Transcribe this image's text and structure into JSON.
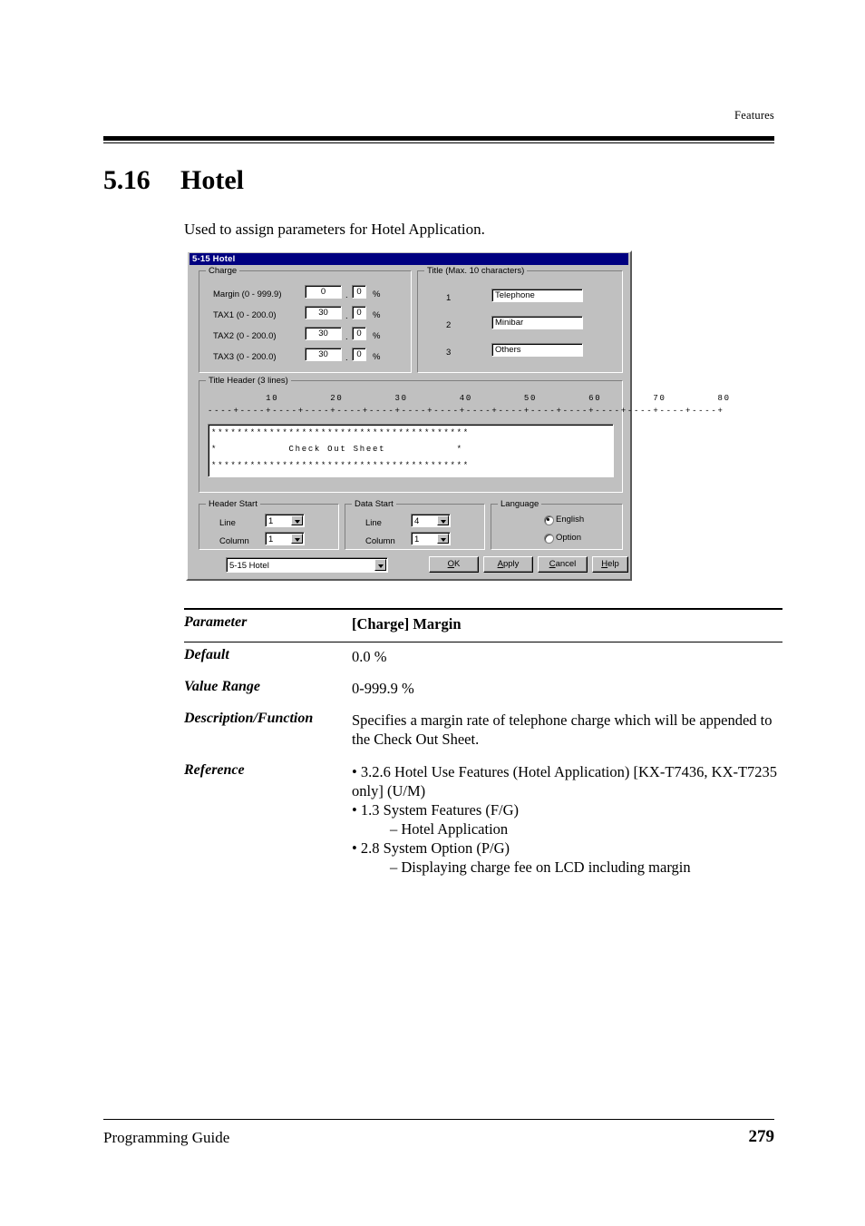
{
  "page": {
    "running_header": "Features",
    "section_number": "5.16",
    "section_title": "Hotel",
    "intro": "Used to assign parameters for Hotel Application.",
    "footer_left": "Programming Guide",
    "footer_page": "279"
  },
  "dialog": {
    "title": "5-15 Hotel",
    "charge": {
      "group_label": "Charge",
      "rows": [
        {
          "label": "Margin (0 - 999.9)",
          "int": "0",
          "dec": "0",
          "unit": "%"
        },
        {
          "label": "TAX1 (0 - 200.0)",
          "int": "30",
          "dec": "0",
          "unit": "%"
        },
        {
          "label": "TAX2 (0 - 200.0)",
          "int": "30",
          "dec": "0",
          "unit": "%"
        },
        {
          "label": "TAX3 (0 - 200.0)",
          "int": "30",
          "dec": "0",
          "unit": "%"
        }
      ],
      "decimal_separator": "."
    },
    "title_group": {
      "group_label": "Title (Max. 10 characters)",
      "rows": [
        {
          "num": "1",
          "value": "Telephone"
        },
        {
          "num": "2",
          "value": "Minibar"
        },
        {
          "num": "3",
          "value": "Others"
        }
      ]
    },
    "title_header": {
      "group_label": "Title Header (3 lines)",
      "ruler_numbers": "         10        20        30        40        50        60        70        80",
      "ruler_ticks": "----+----+----+----+----+----+----+----+----+----+----+----+----+----+----+----+",
      "lines": [
        "****************************************",
        "*           Check Out Sheet           *",
        "****************************************"
      ]
    },
    "header_start": {
      "group_label": "Header Start",
      "line_label": "Line",
      "line_value": "1",
      "column_label": "Column",
      "column_value": "1"
    },
    "data_start": {
      "group_label": "Data Start",
      "line_label": "Line",
      "line_value": "4",
      "column_label": "Column",
      "column_value": "1"
    },
    "language": {
      "group_label": "Language",
      "options": [
        {
          "label": "English",
          "selected": true
        },
        {
          "label": "Option",
          "selected": false
        }
      ]
    },
    "screen_selector": {
      "value": "5-15 Hotel"
    },
    "buttons": [
      {
        "mnemonic": "O",
        "rest": "K"
      },
      {
        "mnemonic": "A",
        "rest": "pply"
      },
      {
        "mnemonic": "C",
        "rest": "ancel"
      },
      {
        "mnemonic": "H",
        "rest": "elp"
      }
    ]
  },
  "parameter_table": {
    "rows": [
      {
        "key": "Parameter",
        "value": "[Charge] Margin",
        "bold": true
      },
      {
        "key": "Default",
        "value": "0.0 %",
        "bold": false
      },
      {
        "key": "Value Range",
        "value": "0-999.9 %",
        "bold": false
      },
      {
        "key": "Description/Function",
        "value": "Specifies a margin rate of telephone charge which will be appended to the Check Out Sheet.",
        "bold": false
      }
    ],
    "reference_key": "Reference",
    "reference_items": [
      {
        "text": "• 3.2.6 Hotel Use Features (Hotel Application) [KX-T7436, KX-T7235 only] (U/M)",
        "sub": false
      },
      {
        "text": "• 1.3 System Features (F/G)",
        "sub": false
      },
      {
        "text": "– Hotel Application",
        "sub": true
      },
      {
        "text": "• 2.8 System Option (P/G)",
        "sub": false
      },
      {
        "text": "– Displaying charge fee on LCD including margin",
        "sub": true
      }
    ]
  },
  "colors": {
    "titlebar": "#000080",
    "dialog_face": "#c0c0c0",
    "field_bg": "#ffffff"
  }
}
